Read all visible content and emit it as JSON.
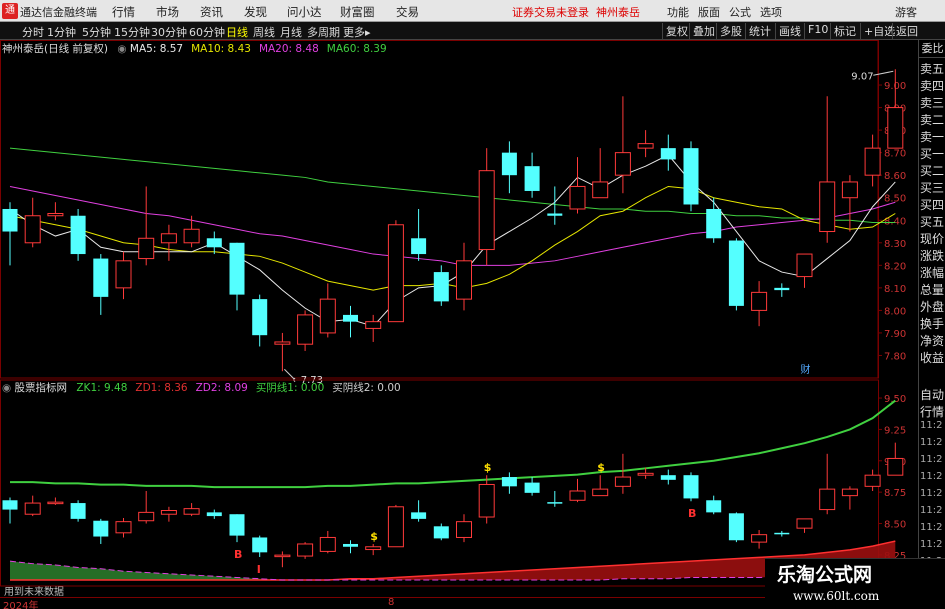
{
  "menu": {
    "app_name": "通达信金融终端",
    "items": [
      "行情",
      "市场",
      "资讯",
      "发现",
      "问小达",
      "财富圈",
      "交易"
    ],
    "status": "证券交易未登录",
    "stock_name": "神州泰岳",
    "right": [
      "功能",
      "版面",
      "公式",
      "选项"
    ],
    "guest": "游客"
  },
  "toolbar": {
    "periods": [
      "分时",
      "1分钟",
      "5分钟",
      "15分钟",
      "30分钟",
      "60分钟",
      "日线",
      "周线",
      "月线",
      "多周期",
      "更多"
    ],
    "active_period": "日线",
    "tools": [
      "复权",
      "叠加",
      "多股",
      "统计",
      "画线",
      "F10",
      "标记",
      "+自选",
      "返回"
    ]
  },
  "main_panel": {
    "title": "神州泰岳(日线 前复权)",
    "indicators": [
      {
        "label": "MA5: 8.57",
        "color": "#e8e8e8"
      },
      {
        "label": "MA10: 8.43",
        "color": "#e6e600"
      },
      {
        "label": "MA20: 8.48",
        "color": "#e040e0"
      },
      {
        "label": "MA60: 8.39",
        "color": "#40d040"
      }
    ],
    "annotation_high": "9.07",
    "annotation_low": "7.73",
    "finance_mark": "财"
  },
  "sub_panel": {
    "title": "股票指标网",
    "indicators": [
      {
        "label": "ZK1: 9.48",
        "color": "#40d040"
      },
      {
        "label": "ZD1: 8.36",
        "color": "#e03030"
      },
      {
        "label": "ZD2: 8.09",
        "color": "#e040e0"
      },
      {
        "label": "买阴线1: 0.00",
        "color": "#40d040"
      },
      {
        "label": "买阴线2: 0.00",
        "color": "#cccccc"
      }
    ],
    "signals": [
      {
        "text": "B",
        "i": 10,
        "color": "#ff3030",
        "pos": "below"
      },
      {
        "text": "I",
        "i": 11,
        "color": "#ff3030",
        "pos": "below"
      },
      {
        "text": "$",
        "i": 16,
        "color": "#ffe000",
        "pos": "above"
      },
      {
        "text": "$",
        "i": 21,
        "color": "#ffe000",
        "pos": "above"
      },
      {
        "text": "$",
        "i": 26,
        "color": "#ffe000",
        "pos": "above"
      },
      {
        "text": "B",
        "i": 30,
        "color": "#ff3030",
        "pos": "below"
      }
    ],
    "note": "用到未来数据"
  },
  "sidebar": {
    "top": "委比",
    "items": [
      "委比",
      "卖五",
      "卖四",
      "卖三",
      "卖二",
      "卖一",
      "买一",
      "买二",
      "买三",
      "买四",
      "买五",
      "现价",
      "涨跌",
      "涨幅",
      "总量",
      "外盘",
      "换手",
      "净资",
      "收益"
    ],
    "lower": [
      "自动",
      "行情",
      "11:2",
      "11:2",
      "11:2",
      "11:2",
      "11:2",
      "11:2",
      "11:2",
      "11:2",
      "11:2",
      "11:2",
      "11:2",
      "11:2"
    ]
  },
  "x_axis": {
    "labels": [
      "2024年",
      "8"
    ]
  },
  "watermark": {
    "line1": "乐淘公式网",
    "line2": "www.60lt.com"
  },
  "chart_data": [
    {
      "type": "candlestick",
      "title": "神州泰岳(日线 前复权)",
      "ylim": [
        7.7,
        9.12
      ],
      "yticks": [
        9.0,
        8.9,
        8.8,
        8.7,
        8.6,
        8.5,
        8.4,
        8.3,
        8.2,
        8.1,
        8.0,
        7.9,
        7.8
      ],
      "candles": [
        [
          8.45,
          8.35,
          8.48,
          8.2
        ],
        [
          8.3,
          8.42,
          8.5,
          8.28
        ],
        [
          8.42,
          8.43,
          8.48,
          8.4
        ],
        [
          8.42,
          8.25,
          8.45,
          8.22
        ],
        [
          8.23,
          8.06,
          8.25,
          7.98
        ],
        [
          8.1,
          8.22,
          8.26,
          8.05
        ],
        [
          8.23,
          8.32,
          8.55,
          8.2
        ],
        [
          8.3,
          8.34,
          8.38,
          8.22
        ],
        [
          8.3,
          8.36,
          8.42,
          8.28
        ],
        [
          8.32,
          8.28,
          8.35,
          8.25
        ],
        [
          8.3,
          8.07,
          8.3,
          8.0
        ],
        [
          8.05,
          7.89,
          8.07,
          7.84
        ],
        [
          7.85,
          7.86,
          7.9,
          7.73
        ],
        [
          7.85,
          7.98,
          8.0,
          7.82
        ],
        [
          7.9,
          8.05,
          8.12,
          7.88
        ],
        [
          7.98,
          7.95,
          8.02,
          7.88
        ],
        [
          7.92,
          7.95,
          7.98,
          7.86
        ],
        [
          7.95,
          8.38,
          8.4,
          7.95
        ],
        [
          8.32,
          8.25,
          8.45,
          8.22
        ],
        [
          8.17,
          8.04,
          8.2,
          8.02
        ],
        [
          8.05,
          8.22,
          8.3,
          8.0
        ],
        [
          8.27,
          8.62,
          8.72,
          8.2
        ],
        [
          8.7,
          8.6,
          8.75,
          8.52
        ],
        [
          8.64,
          8.53,
          8.7,
          8.5
        ],
        [
          8.43,
          8.42,
          8.55,
          8.38
        ],
        [
          8.45,
          8.55,
          8.68,
          8.43
        ],
        [
          8.5,
          8.57,
          8.72,
          8.5
        ],
        [
          8.6,
          8.7,
          8.95,
          8.52
        ],
        [
          8.72,
          8.74,
          8.8,
          8.68
        ],
        [
          8.72,
          8.67,
          8.78,
          8.62
        ],
        [
          8.72,
          8.47,
          8.75,
          8.44
        ],
        [
          8.45,
          8.32,
          8.5,
          8.3
        ],
        [
          8.31,
          8.02,
          8.32,
          8.0
        ],
        [
          8.0,
          8.08,
          8.13,
          7.93
        ],
        [
          8.1,
          8.09,
          8.12,
          8.06
        ],
        [
          8.15,
          8.25,
          8.22,
          8.1
        ],
        [
          8.35,
          8.57,
          8.95,
          8.3
        ],
        [
          8.5,
          8.57,
          8.6,
          8.35
        ],
        [
          8.6,
          8.72,
          8.78,
          8.55
        ],
        [
          8.72,
          8.9,
          9.07,
          8.72
        ]
      ],
      "ma5": [
        8.45,
        8.38,
        8.33,
        8.36,
        8.28,
        8.26,
        8.26,
        8.26,
        8.26,
        8.3,
        8.24,
        8.18,
        8.09,
        8.01,
        7.95,
        7.96,
        7.93,
        8.04,
        8.1,
        8.11,
        8.17,
        8.29,
        8.35,
        8.41,
        8.48,
        8.59,
        8.54,
        8.6,
        8.64,
        8.69,
        8.57,
        8.48,
        8.35,
        8.22,
        8.17,
        8.15,
        8.23,
        8.31,
        8.46,
        8.57
      ],
      "ma10": [
        8.42,
        8.4,
        8.38,
        8.36,
        8.33,
        8.3,
        8.29,
        8.27,
        8.26,
        8.26,
        8.25,
        8.24,
        8.21,
        8.17,
        8.13,
        8.11,
        8.09,
        8.11,
        8.11,
        8.12,
        8.1,
        8.12,
        8.16,
        8.22,
        8.29,
        8.35,
        8.42,
        8.44,
        8.5,
        8.55,
        8.54,
        8.5,
        8.48,
        8.46,
        8.45,
        8.4,
        8.38,
        8.36,
        8.37,
        8.43
      ],
      "ma20": [
        8.55,
        8.53,
        8.51,
        8.49,
        8.47,
        8.45,
        8.43,
        8.42,
        8.4,
        8.38,
        8.36,
        8.34,
        8.33,
        8.31,
        8.29,
        8.27,
        8.25,
        8.24,
        8.23,
        8.22,
        8.2,
        8.2,
        8.2,
        8.21,
        8.22,
        8.24,
        8.26,
        8.28,
        8.3,
        8.32,
        8.34,
        8.35,
        8.37,
        8.38,
        8.39,
        8.4,
        8.41,
        8.43,
        8.45,
        8.48
      ],
      "ma60": [
        8.72,
        8.71,
        8.7,
        8.69,
        8.68,
        8.67,
        8.66,
        8.65,
        8.64,
        8.63,
        8.62,
        8.61,
        8.6,
        8.59,
        8.57,
        8.56,
        8.55,
        8.54,
        8.53,
        8.52,
        8.51,
        8.5,
        8.49,
        8.48,
        8.47,
        8.46,
        8.45,
        8.45,
        8.44,
        8.44,
        8.43,
        8.43,
        8.42,
        8.42,
        8.41,
        8.41,
        8.4,
        8.4,
        8.39,
        8.39
      ]
    },
    {
      "type": "candlestick",
      "title": "股票指标网",
      "ylim": [
        8.05,
        9.58
      ],
      "yticks": [
        9.5,
        9.25,
        9.0,
        8.75,
        8.5,
        8.25
      ],
      "zk1": [
        8.83,
        8.83,
        8.82,
        8.82,
        8.81,
        8.81,
        8.8,
        8.8,
        8.8,
        8.79,
        8.79,
        8.79,
        8.79,
        8.79,
        8.8,
        8.8,
        8.81,
        8.82,
        8.82,
        8.83,
        8.84,
        8.85,
        8.86,
        8.87,
        8.88,
        8.89,
        8.91,
        8.92,
        8.94,
        8.96,
        8.98,
        9.0,
        9.03,
        9.06,
        9.1,
        9.14,
        9.19,
        9.25,
        9.34,
        9.48
      ],
      "zd1": [
        8.05,
        8.05,
        8.05,
        8.05,
        8.05,
        8.05,
        8.05,
        8.05,
        8.05,
        8.05,
        8.05,
        8.05,
        8.05,
        8.05,
        8.05,
        8.06,
        8.06,
        8.07,
        8.08,
        8.09,
        8.1,
        8.11,
        8.12,
        8.13,
        8.14,
        8.15,
        8.16,
        8.17,
        8.18,
        8.19,
        8.2,
        8.21,
        8.22,
        8.23,
        8.24,
        8.25,
        8.27,
        8.29,
        8.32,
        8.36
      ],
      "zd2": [
        8.2,
        8.18,
        8.17,
        8.15,
        8.14,
        8.12,
        8.11,
        8.1,
        8.09,
        8.08,
        8.07,
        8.06,
        8.05,
        8.05,
        8.05,
        8.05,
        8.05,
        8.05,
        8.05,
        8.05,
        8.05,
        8.05,
        8.05,
        8.05,
        8.05,
        8.05,
        8.05,
        8.06,
        8.06,
        8.06,
        8.07,
        8.07,
        8.07,
        8.07,
        8.08,
        8.08,
        8.08,
        8.08,
        8.09,
        8.09
      ]
    }
  ]
}
